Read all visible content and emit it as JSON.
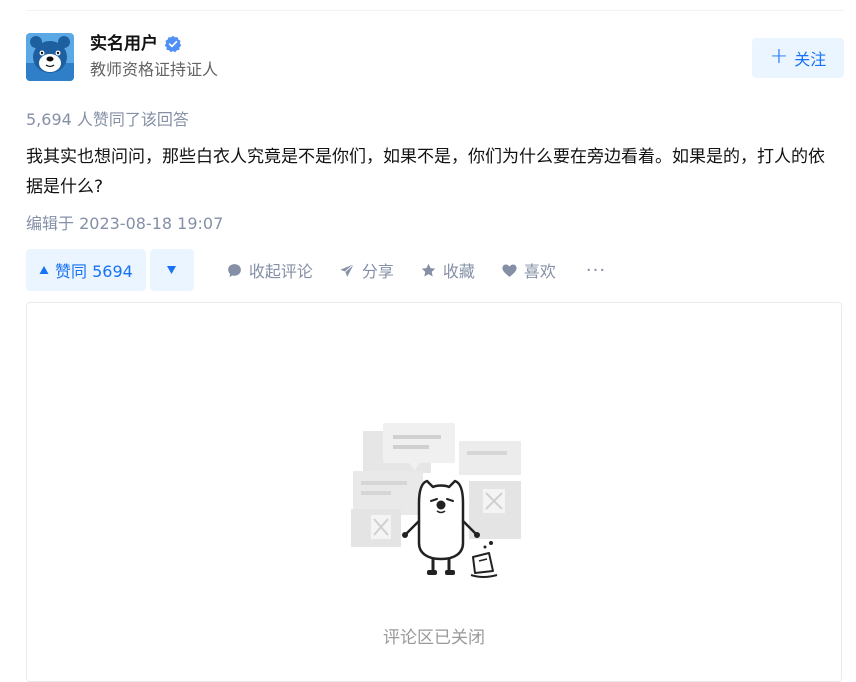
{
  "author": {
    "name": "实名用户",
    "headline": "教师资格证持证人",
    "verified": true,
    "avatar_icon": "blue-bear-avatar"
  },
  "follow": {
    "label": "关注",
    "icon": "plus-icon"
  },
  "answer": {
    "upvote_summary": "5,694 人赞同了该回答",
    "content": "我其实也想问问，那些白衣人究竟是不是你们，如果不是，你们为什么要在旁边看着。如果是的，打人的依据是什么?",
    "edit_time": "编辑于 2023-08-18 19:07"
  },
  "actions": {
    "vote_up_label": "赞同 5694",
    "collapse_comments": "收起评论",
    "share": "分享",
    "favorite": "收藏",
    "like": "喜欢",
    "more": "···"
  },
  "comments": {
    "closed_text": "评论区已关闭"
  },
  "colors": {
    "accent": "#1772f6",
    "accent_bg": "#ebf5ff",
    "muted": "#8590a6",
    "text": "#121212"
  }
}
